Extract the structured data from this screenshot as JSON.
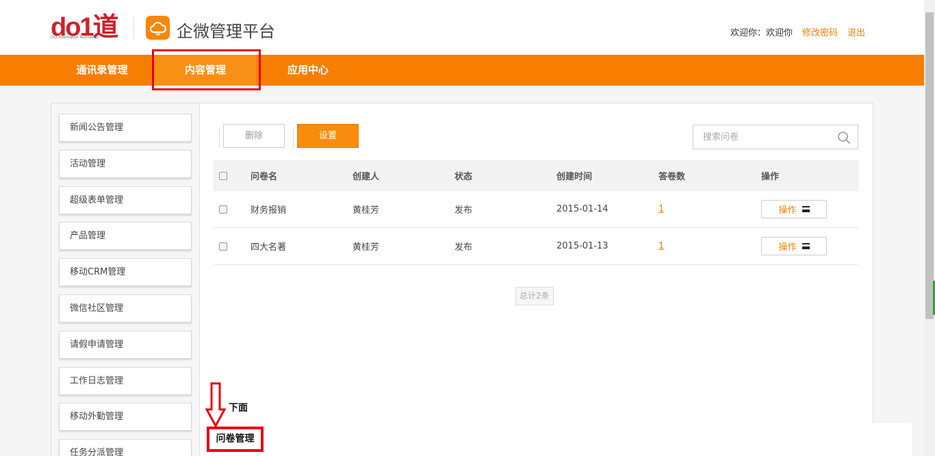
{
  "header": {
    "logo_text": "do1道",
    "logo_sub": "Do1 Information Technology",
    "app_title": "企微管理平台",
    "welcome": "欢迎你：欢迎你",
    "change_password": "修改密码",
    "logout": "退出"
  },
  "nav": {
    "items": [
      {
        "label": "通讯录管理"
      },
      {
        "label": "内容管理"
      },
      {
        "label": "应用中心"
      }
    ],
    "active_index": 1
  },
  "sidebar": {
    "items": [
      {
        "label": "新闻公告管理"
      },
      {
        "label": "活动管理"
      },
      {
        "label": "超级表单管理"
      },
      {
        "label": "产品管理"
      },
      {
        "label": "移动CRM管理"
      },
      {
        "label": "微信社区管理"
      },
      {
        "label": "请假申请管理"
      },
      {
        "label": "工作日志管理"
      },
      {
        "label": "移动外勤管理"
      },
      {
        "label": "任务分派管理"
      }
    ]
  },
  "toolbar": {
    "delete_label": "删除",
    "settings_label": "设置",
    "search_placeholder": "搜索问卷"
  },
  "table": {
    "columns": [
      "问卷名",
      "创建人",
      "状态",
      "创建时间",
      "答卷数",
      "操作"
    ],
    "rows": [
      {
        "name": "财务报销",
        "creator": "黄桂芳",
        "status": "发布",
        "created": "2015-01-14",
        "answers": "1",
        "action": "操作"
      },
      {
        "name": "四大名著",
        "creator": "黄桂芳",
        "status": "发布",
        "created": "2015-01-13",
        "answers": "1",
        "action": "操作"
      }
    ],
    "total": "总计2条"
  },
  "annotation": {
    "hint": "下面",
    "target": "问卷管理"
  },
  "colors": {
    "accent": "#f77e00",
    "highlight": "#e60012",
    "logo": "#d0202a"
  }
}
